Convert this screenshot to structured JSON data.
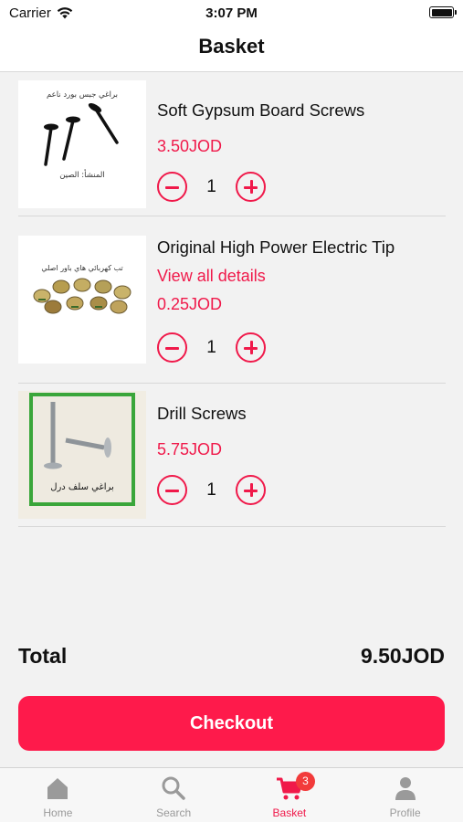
{
  "status_bar": {
    "carrier": "Carrier",
    "time": "3:07 PM"
  },
  "nav": {
    "title": "Basket"
  },
  "items": [
    {
      "name": "Soft Gypsum Board Screws",
      "price": "3.50JOD",
      "quantity": "1",
      "thumb_caption_top": "براغي جبس بورد ناعم",
      "thumb_caption_bottom": "المنشأ: الصين"
    },
    {
      "name": "Original High Power Electric Tip",
      "link": "View all details",
      "price": "0.25JOD",
      "quantity": "1",
      "thumb_caption_top": "تب كهربائي هاي باور اصلي"
    },
    {
      "name": "Drill Screws",
      "price": "5.75JOD",
      "quantity": "1",
      "thumb_caption_bottom": "براغي سلف درل"
    }
  ],
  "total": {
    "label": "Total",
    "value": "9.50JOD"
  },
  "checkout": {
    "label": "Checkout"
  },
  "tabs": [
    {
      "label": "Home",
      "icon": "home-icon"
    },
    {
      "label": "Search",
      "icon": "search-icon"
    },
    {
      "label": "Basket",
      "icon": "cart-icon",
      "badge": "3"
    },
    {
      "label": "Profile",
      "icon": "profile-icon"
    }
  ],
  "colors": {
    "accent": "#f0194a",
    "checkout": "#fe1a4b",
    "badge": "#f23b3b",
    "inactive_tab": "#9a9a9a"
  }
}
